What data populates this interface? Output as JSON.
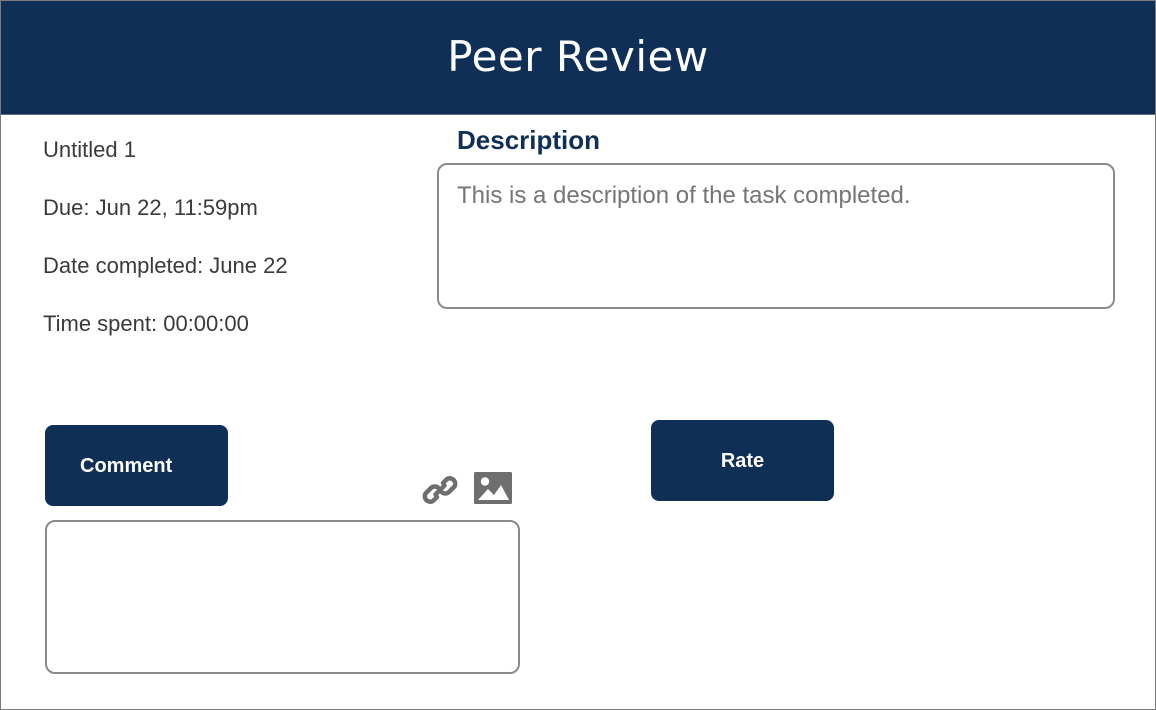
{
  "header": {
    "title": "Peer Review"
  },
  "task": {
    "name": "Untitled 1",
    "due": "Due: Jun 22, 11:59pm",
    "date_completed": "Date completed: June 22",
    "time_spent": "Time spent: 00:00:00"
  },
  "description": {
    "heading": "Description",
    "placeholder": "This is a description of the task completed."
  },
  "comment": {
    "button_label": "Comment",
    "value": "",
    "attach_icon": "link-icon",
    "image_icon": "image-icon"
  },
  "rate": {
    "button_label": "Rate"
  },
  "colors": {
    "primary": "#0f2f56",
    "text": "#3a3a3a",
    "placeholder": "#808080",
    "border": "#8a8a8a",
    "icon": "#6e6e6e"
  }
}
